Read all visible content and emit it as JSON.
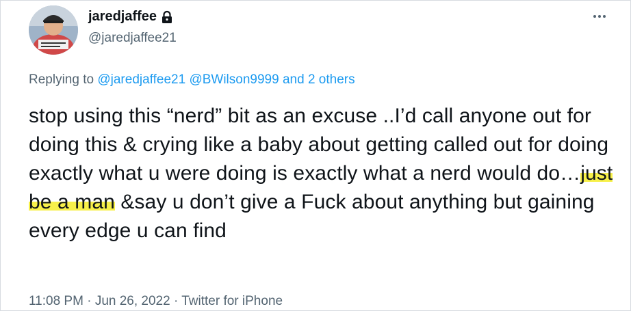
{
  "author": {
    "display_name": "jaredjaffee",
    "handle": "@jaredjaffee21",
    "protected_icon": "lock-icon",
    "avatar_icon": "user-avatar"
  },
  "more_icon": "more-horizontal-icon",
  "reply": {
    "prefix": "Replying to",
    "user1": "@jaredjaffee21",
    "user2": "@BWilson9999",
    "others": "and 2 others"
  },
  "tweet": {
    "text_before": "stop using this “nerd” bit as an excuse ..I’d call anyone out for doing this & crying like a baby about getting called out for doing exactly what u were doing is exactly what a nerd would do…",
    "text_highlight": "just be a man",
    "text_after": " &say u don’t give a Fuck about anything but gaining every edge u can find",
    "highlight_color": "#f7f04a"
  },
  "meta": {
    "time": "11:08 PM",
    "separator": "·",
    "date": "Jun 26, 2022",
    "source": "Twitter for iPhone"
  },
  "colors": {
    "text": "#0f1419",
    "muted": "#536471",
    "link": "#1d9bf0"
  }
}
